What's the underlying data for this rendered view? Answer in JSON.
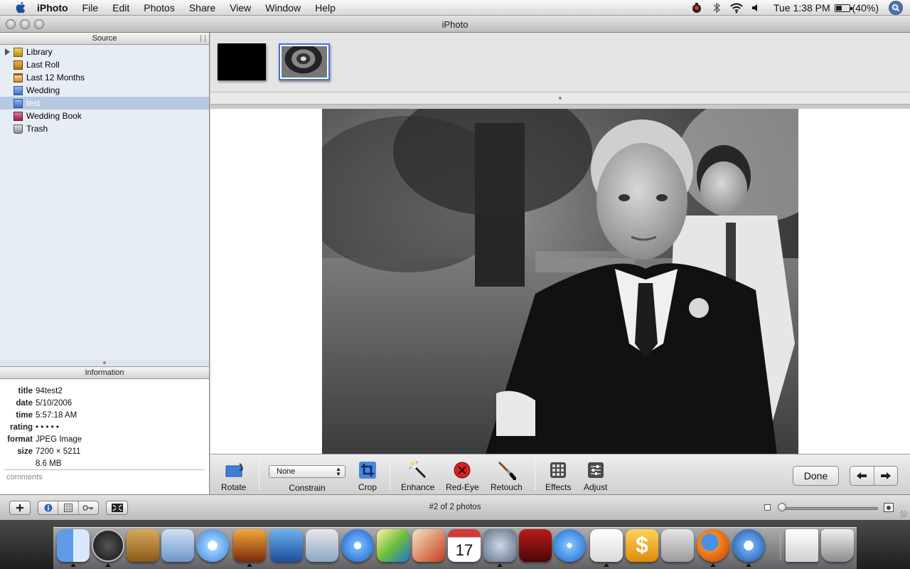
{
  "menubar": {
    "app": "iPhoto",
    "menus": [
      "File",
      "Edit",
      "Photos",
      "Share",
      "View",
      "Window",
      "Help"
    ],
    "clock": "Tue 1:38 PM",
    "battery": "(40%)",
    "battery_level": 0.4
  },
  "window": {
    "title": "iPhoto"
  },
  "source": {
    "header": "Source",
    "items": [
      {
        "label": "Library",
        "icon": "library-icon"
      },
      {
        "label": "Last Roll",
        "icon": "film-roll-icon"
      },
      {
        "label": "Last 12 Months",
        "icon": "calendar-icon"
      },
      {
        "label": "Wedding",
        "icon": "album-icon"
      },
      {
        "label": "test",
        "icon": "album-icon"
      },
      {
        "label": "Wedding Book",
        "icon": "book-icon"
      },
      {
        "label": "Trash",
        "icon": "trash-icon"
      }
    ],
    "selected_index": 4
  },
  "information": {
    "header": "Information",
    "rows": [
      {
        "label": "title",
        "value": "94test2"
      },
      {
        "label": "date",
        "value": "5/10/2006"
      },
      {
        "label": "time",
        "value": "5:57:18 AM"
      },
      {
        "label": "rating",
        "value": "• • • • •"
      },
      {
        "label": "format",
        "value": "JPEG Image"
      },
      {
        "label": "size",
        "value": "7200 × 5211"
      },
      {
        "label": "",
        "value": "8.6 MB"
      }
    ],
    "comments_placeholder": "comments"
  },
  "edit_toolbar": {
    "rotate": "Rotate",
    "constrain_value": "None",
    "constrain_label": "Constrain",
    "crop": "Crop",
    "enhance": "Enhance",
    "redeye": "Red-Eye",
    "retouch": "Retouch",
    "effects": "Effects",
    "adjust": "Adjust",
    "done": "Done"
  },
  "bottom_bar": {
    "photo_count": "#2 of 2 photos",
    "zoom_level": 0.0
  },
  "colors": {
    "selection": "#b6c9e3",
    "source_bg": "#e7edf5",
    "thumb_border": "#3d78d8",
    "redeye": "#d42222"
  },
  "dock": {
    "icons": [
      "finder-icon",
      "dashboard-icon",
      "address-book-icon",
      "mail-icon",
      "itunes-icon",
      "iphoto-icon",
      "imovie-icon",
      "preview-icon",
      "dvd-player-icon",
      "graphic-converter-icon",
      "painter-icon",
      "ical-icon",
      "automator-icon",
      "front-row-icon",
      "photo-booth-icon",
      "safari-icon",
      "textedit-icon",
      "money-icon",
      "calculator-icon",
      "firefox-icon",
      "time-sync-icon",
      "document-icon",
      "trash-icon"
    ]
  }
}
